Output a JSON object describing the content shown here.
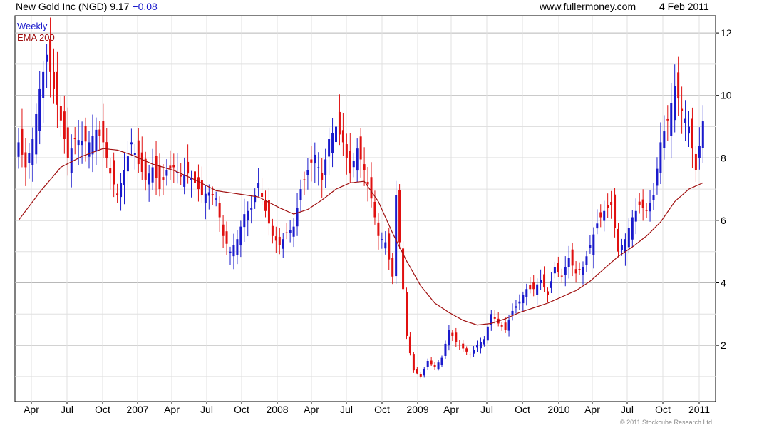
{
  "header": {
    "title": "New Gold Inc (NGD) 9.17",
    "change": "+0.08",
    "site": "www.fullermoney.com",
    "date": "4 Feb 2011"
  },
  "legend": {
    "weekly": "Weekly",
    "ema": "EMA 200"
  },
  "copyright": "© 2011 Stockcube Research Ltd",
  "colors": {
    "up": "#1a1acc",
    "down": "#e01010",
    "ema": "#a01010",
    "grid": "#cccccc",
    "axis": "#000000"
  },
  "chart_data": {
    "type": "candlestick",
    "title": "New Gold Inc (NGD) 9.17 +0.08",
    "frequency": "Weekly",
    "ylim": [
      0.5,
      12.3
    ],
    "y_ticks": [
      2,
      4,
      6,
      8,
      10,
      12
    ],
    "grid": true,
    "x_tick_labels": [
      "Apr",
      "Jul",
      "Oct",
      "2007",
      "Apr",
      "Jul",
      "Oct",
      "2008",
      "Apr",
      "Jul",
      "Oct",
      "2009",
      "Apr",
      "Jul",
      "Oct",
      "2010",
      "Apr",
      "Jul",
      "Oct",
      "2011"
    ],
    "close_anchors": [
      [
        0,
        8.5
      ],
      [
        2,
        7.7
      ],
      [
        4,
        8.6
      ],
      [
        6,
        10.2
      ],
      [
        8,
        11.3
      ],
      [
        10,
        10.2
      ],
      [
        12,
        9.2
      ],
      [
        14,
        8.0
      ],
      [
        16,
        8.6
      ],
      [
        20,
        8.5
      ],
      [
        22,
        8.9
      ],
      [
        24,
        8.5
      ],
      [
        26,
        7.5
      ],
      [
        28,
        6.8
      ],
      [
        30,
        7.6
      ],
      [
        32,
        8.5
      ],
      [
        34,
        7.8
      ],
      [
        36,
        7.3
      ],
      [
        38,
        7.7
      ],
      [
        40,
        7.0
      ],
      [
        42,
        7.6
      ],
      [
        44,
        7.7
      ],
      [
        46,
        7.4
      ],
      [
        48,
        7.5
      ],
      [
        50,
        7.2
      ],
      [
        52,
        6.8
      ],
      [
        54,
        6.9
      ],
      [
        56,
        6.7
      ],
      [
        58,
        5.5
      ],
      [
        60,
        5.0
      ],
      [
        62,
        5.4
      ],
      [
        64,
        6.2
      ],
      [
        66,
        6.4
      ],
      [
        68,
        7.2
      ],
      [
        70,
        6.3
      ],
      [
        72,
        5.5
      ],
      [
        74,
        5.2
      ],
      [
        76,
        5.6
      ],
      [
        78,
        5.8
      ],
      [
        80,
        7.0
      ],
      [
        82,
        7.6
      ],
      [
        84,
        8.1
      ],
      [
        86,
        7.3
      ],
      [
        88,
        8.6
      ],
      [
        90,
        9.0
      ],
      [
        92,
        8.5
      ],
      [
        94,
        7.5
      ],
      [
        96,
        8.3
      ],
      [
        98,
        7.6
      ],
      [
        100,
        6.7
      ],
      [
        102,
        5.5
      ],
      [
        104,
        5.3
      ],
      [
        106,
        4.2
      ],
      [
        107,
        6.8
      ],
      [
        108,
        5.3
      ],
      [
        110,
        2.3
      ],
      [
        112,
        1.2
      ],
      [
        114,
        1.0
      ],
      [
        116,
        1.5
      ],
      [
        118,
        1.3
      ],
      [
        120,
        1.6
      ],
      [
        122,
        2.5
      ],
      [
        124,
        2.1
      ],
      [
        126,
        1.9
      ],
      [
        128,
        1.7
      ],
      [
        130,
        2.0
      ],
      [
        132,
        2.2
      ],
      [
        134,
        3.0
      ],
      [
        136,
        2.7
      ],
      [
        138,
        2.5
      ],
      [
        140,
        3.1
      ],
      [
        142,
        3.4
      ],
      [
        144,
        3.8
      ],
      [
        146,
        3.8
      ],
      [
        148,
        4.1
      ],
      [
        150,
        3.6
      ],
      [
        152,
        4.5
      ],
      [
        154,
        4.2
      ],
      [
        156,
        4.8
      ],
      [
        158,
        4.3
      ],
      [
        160,
        4.5
      ],
      [
        162,
        5.2
      ],
      [
        164,
        5.9
      ],
      [
        166,
        6.3
      ],
      [
        168,
        6.5
      ],
      [
        170,
        5.0
      ],
      [
        172,
        5.4
      ],
      [
        174,
        6.1
      ],
      [
        176,
        6.5
      ],
      [
        178,
        6.3
      ],
      [
        180,
        6.8
      ],
      [
        182,
        8.5
      ],
      [
        184,
        9.2
      ],
      [
        186,
        10.3
      ],
      [
        188,
        9.5
      ],
      [
        190,
        9.0
      ],
      [
        192,
        7.6
      ],
      [
        194,
        9.17
      ]
    ],
    "ema_anchors": [
      [
        0,
        6.0
      ],
      [
        6,
        6.9
      ],
      [
        12,
        7.7
      ],
      [
        18,
        8.05
      ],
      [
        24,
        8.3
      ],
      [
        28,
        8.25
      ],
      [
        32,
        8.1
      ],
      [
        38,
        7.8
      ],
      [
        44,
        7.6
      ],
      [
        50,
        7.3
      ],
      [
        56,
        6.95
      ],
      [
        62,
        6.85
      ],
      [
        68,
        6.75
      ],
      [
        74,
        6.4
      ],
      [
        78,
        6.2
      ],
      [
        82,
        6.35
      ],
      [
        86,
        6.65
      ],
      [
        90,
        7.0
      ],
      [
        94,
        7.2
      ],
      [
        98,
        7.25
      ],
      [
        102,
        6.6
      ],
      [
        106,
        5.6
      ],
      [
        110,
        4.7
      ],
      [
        114,
        3.9
      ],
      [
        118,
        3.35
      ],
      [
        122,
        3.05
      ],
      [
        126,
        2.8
      ],
      [
        130,
        2.65
      ],
      [
        134,
        2.7
      ],
      [
        138,
        2.85
      ],
      [
        142,
        3.05
      ],
      [
        146,
        3.2
      ],
      [
        150,
        3.35
      ],
      [
        154,
        3.55
      ],
      [
        158,
        3.75
      ],
      [
        162,
        4.05
      ],
      [
        166,
        4.45
      ],
      [
        170,
        4.85
      ],
      [
        174,
        5.15
      ],
      [
        178,
        5.5
      ],
      [
        182,
        5.95
      ],
      [
        186,
        6.6
      ],
      [
        190,
        7.0
      ],
      [
        194,
        7.2
      ]
    ]
  }
}
